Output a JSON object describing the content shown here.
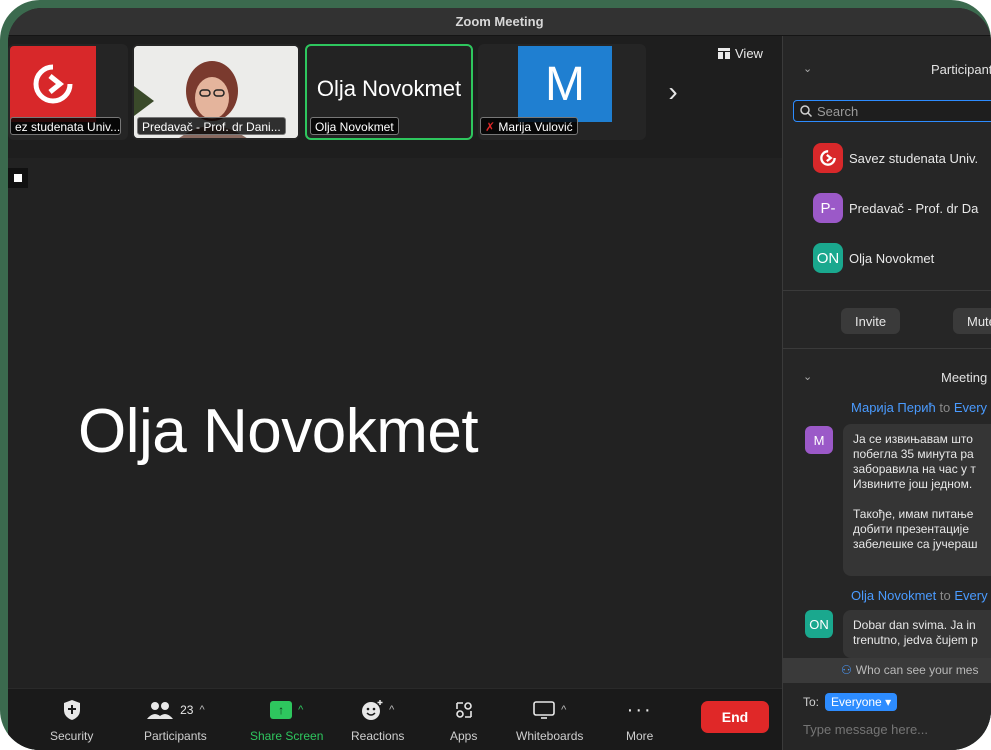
{
  "window": {
    "title": "Zoom Meeting"
  },
  "video_strip": {
    "tiles": [
      {
        "label": "ez studenata Univ..."
      },
      {
        "label": "Predavač - Prof. dr Dani..."
      },
      {
        "label": "Olja Novokmet",
        "big_name": "Olja Novokmet"
      },
      {
        "label": "Marija Vulović",
        "avatar_letter": "M"
      }
    ],
    "view_label": "View"
  },
  "main_speaker": {
    "name": "Olja Novokmet"
  },
  "toolbar": {
    "security_label": "Security",
    "participants_label": "Participants",
    "participants_count": "23",
    "share_label": "Share Screen",
    "reactions_label": "Reactions",
    "apps_label": "Apps",
    "whiteboards_label": "Whiteboards",
    "more_label": "More",
    "end_label": "End"
  },
  "participants_panel": {
    "title": "Participant",
    "search_placeholder": "Search",
    "list": [
      {
        "name": "Savez studenata Univ."
      },
      {
        "name": "Predavač - Prof. dr Da",
        "initials": "P-"
      },
      {
        "name": "Olja Novokmet",
        "initials": "ON"
      }
    ],
    "invite_label": "Invite",
    "mute_label": "Mute A"
  },
  "chat_panel": {
    "title": "Meeting (",
    "messages": [
      {
        "sender": "Марија Перић",
        "to": "to",
        "to_who": "Every",
        "initial": "M",
        "lines": [
          "Ја се извињавам што",
          "побегла 35 минута ра",
          "заборавила на час у т",
          "Извините још једном."
        ],
        "lines2": [
          "Такође, имам питање",
          "добити презентације",
          "забелешке са јучераш"
        ]
      },
      {
        "sender": "Olja Novokmet",
        "to": "to",
        "to_who": "Every",
        "initial": "ON",
        "lines": [
          "Dobar dan svima. Ja in",
          "trenutno, jedva čujem p"
        ]
      }
    ],
    "who_can_see": "Who can see your mes",
    "to_label": "To:",
    "to_value": "Everyone",
    "input_placeholder": "Type message here..."
  },
  "colors": {
    "accent_blue": "#2d8cff",
    "green": "#2ec65e",
    "end_red": "#e02828",
    "frame_green": "#3b6a4e"
  }
}
